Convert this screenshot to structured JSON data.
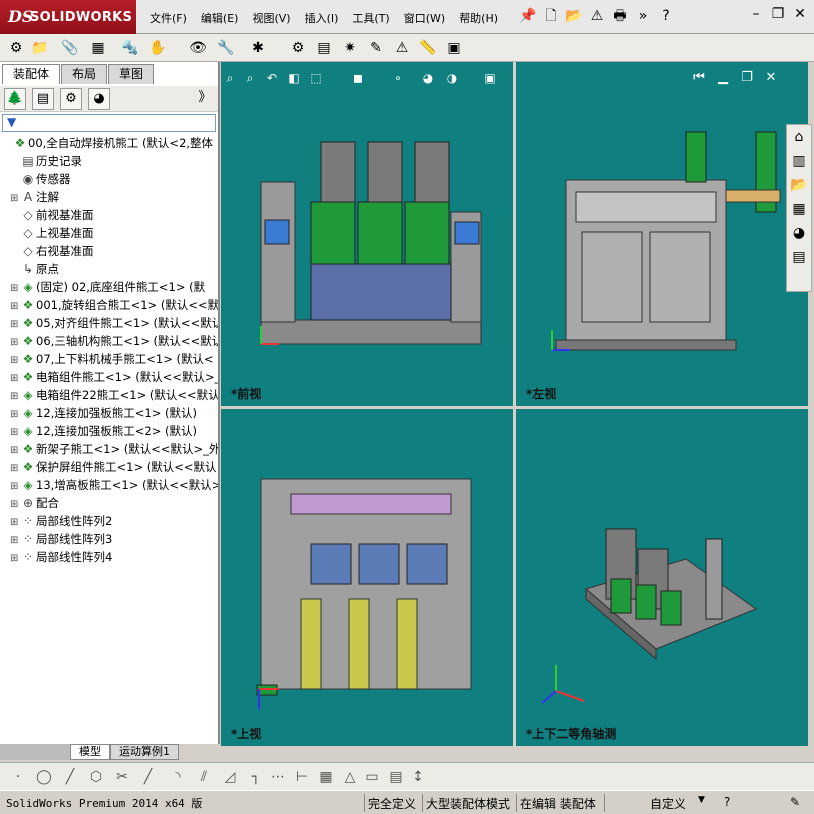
{
  "app": {
    "logo_ds": "DS",
    "logo_name": "SOLIDWORKS"
  },
  "menu": [
    "文件(F)",
    "编辑(E)",
    "视图(V)",
    "插入(I)",
    "工具(T)",
    "窗口(W)",
    "帮助(H)"
  ],
  "overflow_label": "》",
  "left_tabs": [
    "装配体",
    "布局",
    "草图"
  ],
  "tree": [
    {
      "label": "00,全自动焊接机熊工  (默认<2,整体",
      "icon": "assembly-icon",
      "expander": ""
    },
    {
      "label": "历史记录",
      "icon": "history-icon",
      "expander": ""
    },
    {
      "label": "传感器",
      "icon": "sensor-icon",
      "expander": ""
    },
    {
      "label": "注解",
      "icon": "annotation-icon",
      "expander": "+"
    },
    {
      "label": "前视基准面",
      "icon": "plane-icon",
      "expander": ""
    },
    {
      "label": "上视基准面",
      "icon": "plane-icon",
      "expander": ""
    },
    {
      "label": "右视基准面",
      "icon": "plane-icon",
      "expander": ""
    },
    {
      "label": "原点",
      "icon": "origin-icon",
      "expander": ""
    },
    {
      "label": "(固定) 02,底座组件熊工<1> (默",
      "icon": "part-icon",
      "expander": "+"
    },
    {
      "label": "001,旋转组合熊工<1> (默认<<默",
      "icon": "assembly-icon",
      "expander": "+"
    },
    {
      "label": "05,对齐组件熊工<1> (默认<<默认",
      "icon": "assembly-icon",
      "expander": "+"
    },
    {
      "label": "06,三轴机构熊工<1> (默认<<默认",
      "icon": "assembly-icon",
      "expander": "+"
    },
    {
      "label": "07,上下料机械手熊工<1> (默认<",
      "icon": "assembly-icon",
      "expander": "+"
    },
    {
      "label": "电箱组件熊工<1> (默认<<默认>_",
      "icon": "assembly-icon",
      "expander": "+"
    },
    {
      "label": "电箱组件22熊工<1> (默认<<默认",
      "icon": "part-icon",
      "expander": "+"
    },
    {
      "label": "12,连接加强板熊工<1> (默认)",
      "icon": "part-icon",
      "expander": "+"
    },
    {
      "label": "12,连接加强板熊工<2> (默认)",
      "icon": "part-icon",
      "expander": "+"
    },
    {
      "label": "新架子熊工<1> (默认<<默认>_外",
      "icon": "assembly-icon",
      "expander": "+"
    },
    {
      "label": "保护屏组件熊工<1> (默认<<默认",
      "icon": "assembly-icon",
      "expander": "+"
    },
    {
      "label": "13,增高板熊工<1> (默认<<默认>",
      "icon": "part-icon",
      "expander": "+"
    },
    {
      "label": "配合",
      "icon": "mate-icon",
      "expander": "+"
    },
    {
      "label": "局部线性阵列2",
      "icon": "pattern-icon",
      "expander": "+"
    },
    {
      "label": "局部线性阵列3",
      "icon": "pattern-icon",
      "expander": "+"
    },
    {
      "label": "局部线性阵列4",
      "icon": "pattern-icon",
      "expander": "+"
    }
  ],
  "bottom_tabs": [
    "模型",
    "运动算例1"
  ],
  "viewports": [
    {
      "label": "*前视"
    },
    {
      "label": "*左视"
    },
    {
      "label": "*上视"
    },
    {
      "label": "*上下二等角轴测"
    }
  ],
  "status": {
    "product": "SolidWorks Premium 2014 x64 版",
    "definition": "完全定义",
    "mode": "大型装配体模式",
    "editing": "在编辑 装配体",
    "units": "自定义"
  },
  "colors": {
    "viewport_bg": "#0f7f7f",
    "logo_red": "#b81f2a",
    "machine_green": "#1e9a3a"
  }
}
